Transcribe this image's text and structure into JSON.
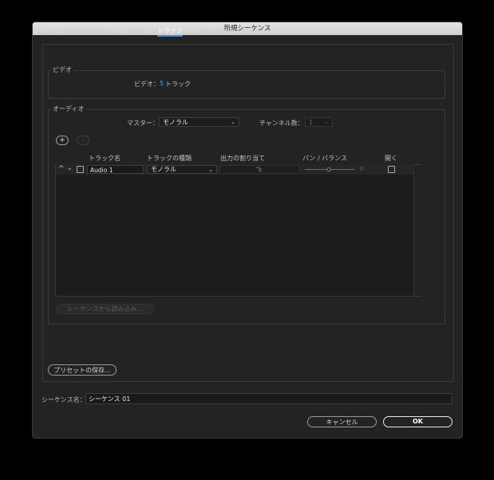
{
  "window": {
    "title": "新規シーケンス"
  },
  "tabs": [
    {
      "label": "シーケンスプリセット"
    },
    {
      "label": "設定"
    },
    {
      "label": "トラック"
    },
    {
      "label": "VR ビデオ"
    }
  ],
  "video": {
    "legend": "ビデオ",
    "label": "ビデオ：",
    "count": "5",
    "unit": "トラック"
  },
  "audio": {
    "legend": "オーディオ",
    "master_label": "マスター：",
    "master_value": "モノラル",
    "channels_label": "チャンネル数：",
    "channels_value": "1",
    "add_label": "+",
    "remove_label": "-"
  },
  "track_table": {
    "headers": [
      "トラック名",
      "トラックの種類",
      "出力の割り当て",
      "パン / バランス",
      "開く"
    ],
    "rows": [
      {
        "name": "Audio 1",
        "type": "モノラル",
        "pan_value": "0"
      }
    ]
  },
  "buttons": {
    "import_from_sequence": "シーケンスから読み込み...",
    "save_preset": "プリセットの保存...",
    "cancel": "キャンセル",
    "ok": "OK"
  },
  "sequence_name": {
    "label": "シーケンス名：",
    "value": "シーケンス 01"
  }
}
